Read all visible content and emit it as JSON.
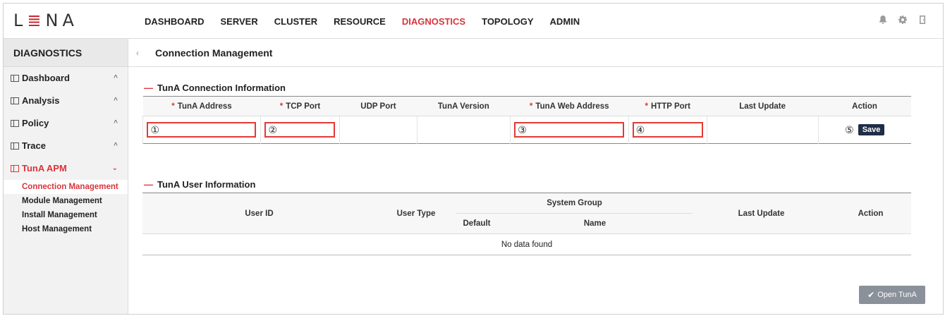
{
  "header": {
    "logo": {
      "left": "L",
      "mark": "≣",
      "right": "NA"
    },
    "nav": [
      "DASHBOARD",
      "SERVER",
      "CLUSTER",
      "RESOURCE",
      "DIAGNOSTICS",
      "TOPOLOGY",
      "ADMIN"
    ],
    "active_nav": "DIAGNOSTICS",
    "icons": [
      "bell-icon",
      "gear-icon",
      "exit-icon"
    ]
  },
  "sidebar": {
    "title": "DIAGNOSTICS",
    "groups": [
      {
        "label": "Dashboard",
        "chevron": "^"
      },
      {
        "label": "Analysis",
        "chevron": "^"
      },
      {
        "label": "Policy",
        "chevron": "^"
      },
      {
        "label": "Trace",
        "chevron": "^"
      },
      {
        "label": "TunA APM",
        "chevron": "⌄"
      }
    ],
    "sub_items": [
      "Connection Management",
      "Module Management",
      "Install Management",
      "Host Management"
    ]
  },
  "page": {
    "collapse_icon": "‹",
    "title": "Connection Management"
  },
  "connection": {
    "section_title": "TunA Connection Information",
    "columns": [
      {
        "label": "TunA Address",
        "required": true
      },
      {
        "label": "TCP Port",
        "required": true
      },
      {
        "label": "UDP Port",
        "required": false
      },
      {
        "label": "TunA Version",
        "required": false
      },
      {
        "label": "TunA Web Address",
        "required": true
      },
      {
        "label": "HTTP Port",
        "required": true
      },
      {
        "label": "Last Update",
        "required": false
      },
      {
        "label": "Action",
        "required": false
      }
    ],
    "row": {
      "address_marker": "①",
      "tcp_marker": "②",
      "web_marker": "③",
      "http_marker": "④",
      "action_marker": "⑤",
      "save_label": "Save"
    },
    "required_mark": "*"
  },
  "users": {
    "section_title": "TunA User Information",
    "columns": {
      "user_id": "User ID",
      "user_type": "User Type",
      "system_group": "System Group",
      "default": "Default",
      "name": "Name",
      "last_update": "Last Update",
      "action": "Action"
    },
    "empty_text": "No data found"
  },
  "footer": {
    "open_label": "Open TunA",
    "open_icon": "✔"
  },
  "colors": {
    "accent": "#d9343b",
    "save_button": "#1f2d46",
    "open_button": "#8b919a",
    "field_highlight": "#e53935"
  }
}
